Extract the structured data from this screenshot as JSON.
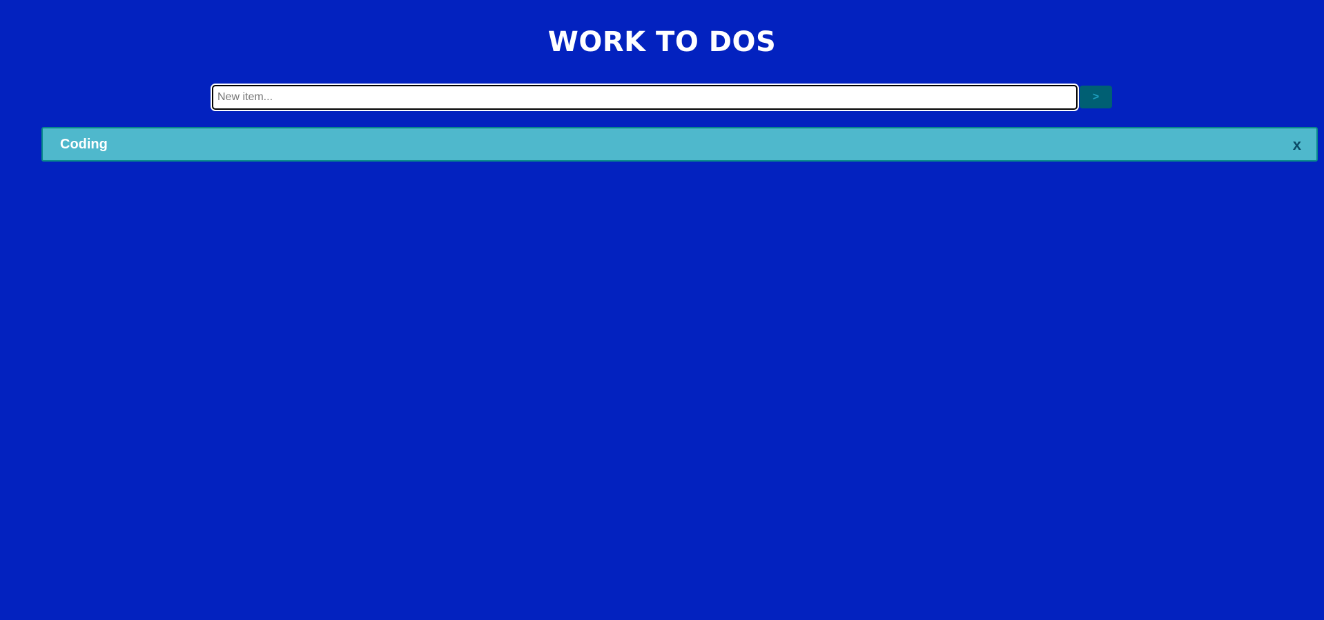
{
  "header": {
    "title": "WORK TO DOS"
  },
  "form": {
    "placeholder": "New item...",
    "value": "",
    "submit_label": ">"
  },
  "todos": [
    {
      "label": "Coding",
      "delete_label": "x"
    }
  ],
  "colors": {
    "background": "#0322bf",
    "item_background": "#4fb8cc",
    "button_background": "#005f73"
  }
}
